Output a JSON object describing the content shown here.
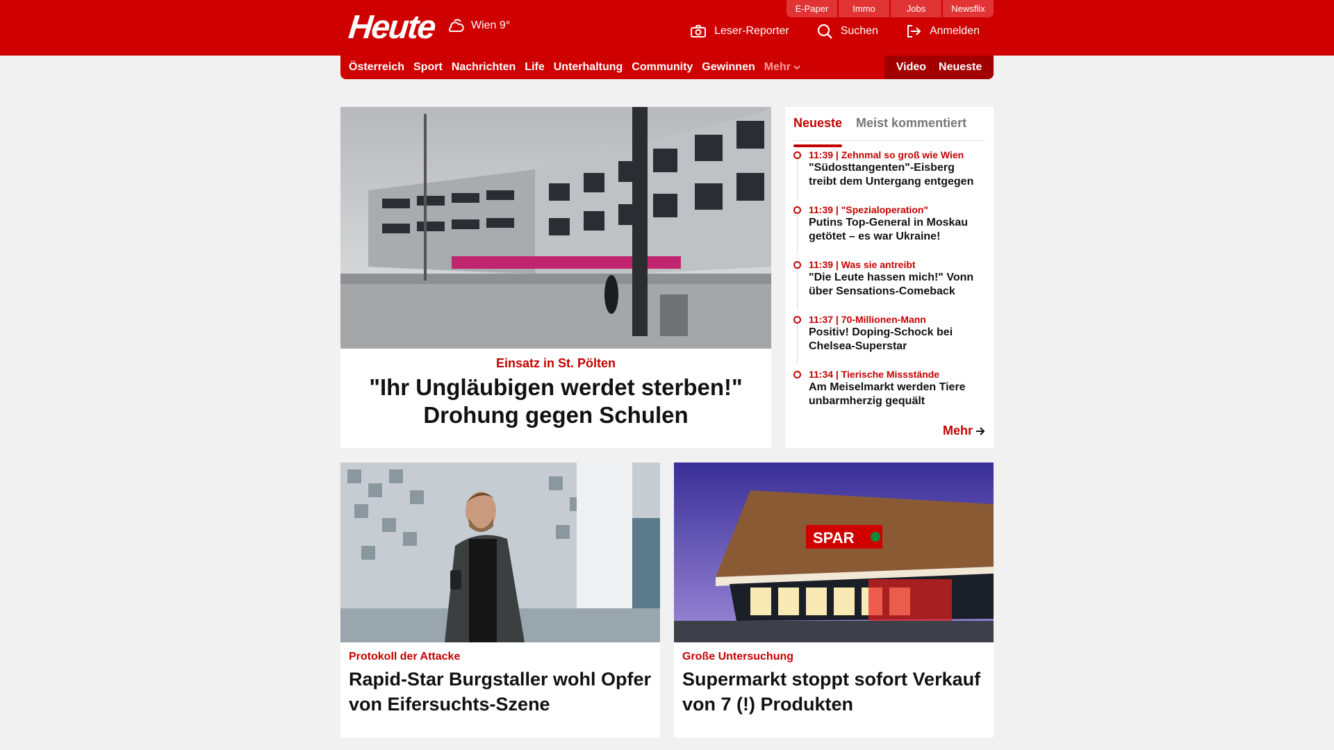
{
  "header": {
    "logo": "Heute",
    "weather": "Wien 9°",
    "top_links": [
      "E-Paper",
      "Immo",
      "Jobs",
      "Newsflix"
    ],
    "actions": {
      "reporter": "Leser-Reporter",
      "search": "Suchen",
      "login": "Anmelden"
    }
  },
  "nav": {
    "items": [
      "Österreich",
      "Sport",
      "Nachrichten",
      "Life",
      "Unterhaltung",
      "Community",
      "Gewinnen"
    ],
    "more": "Mehr",
    "video": "Video",
    "latest": "Neueste"
  },
  "hero": {
    "kicker": "Einsatz in St. Pölten",
    "title": "\"Ihr Ungläubigen werdet sterben!\" Drohung gegen Schulen"
  },
  "sidebar": {
    "tabs": [
      "Neueste",
      "Meist kommentiert"
    ],
    "items": [
      {
        "meta": "11:39 | Zehnmal so groß wie Wien",
        "title": "\"Südosttangenten\"-Eisberg treibt dem Untergang entgegen"
      },
      {
        "meta": "11:39 | \"Spezialoperation\"",
        "title": "Putins Top-General in Moskau getötet – es war Ukraine!"
      },
      {
        "meta": "11:39 | Was sie antreibt",
        "title": "\"Die Leute hassen mich!\" Vonn über Sensations-Comeback"
      },
      {
        "meta": "11:37 | 70-Millionen-Mann",
        "title": "Positiv! Doping-Schock bei Chelsea-Superstar"
      },
      {
        "meta": "11:34 | Tierische Missstände",
        "title": "Am Meiselmarkt werden Tiere unbarmherzig gequält"
      }
    ],
    "more": "Mehr"
  },
  "cards": [
    {
      "kicker": "Protokoll der Attacke",
      "title": "Rapid-Star Burgstaller wohl Opfer von Eifersuchts-Szene"
    },
    {
      "kicker": "Große Untersuchung",
      "title": "Supermarkt stoppt sofort Verkauf von 7 (!) Produkten"
    }
  ],
  "store_sign": "SPAR",
  "colors": {
    "brand": "#cf0000",
    "brand_dark": "#a20000",
    "background": "#f1f1f1"
  }
}
